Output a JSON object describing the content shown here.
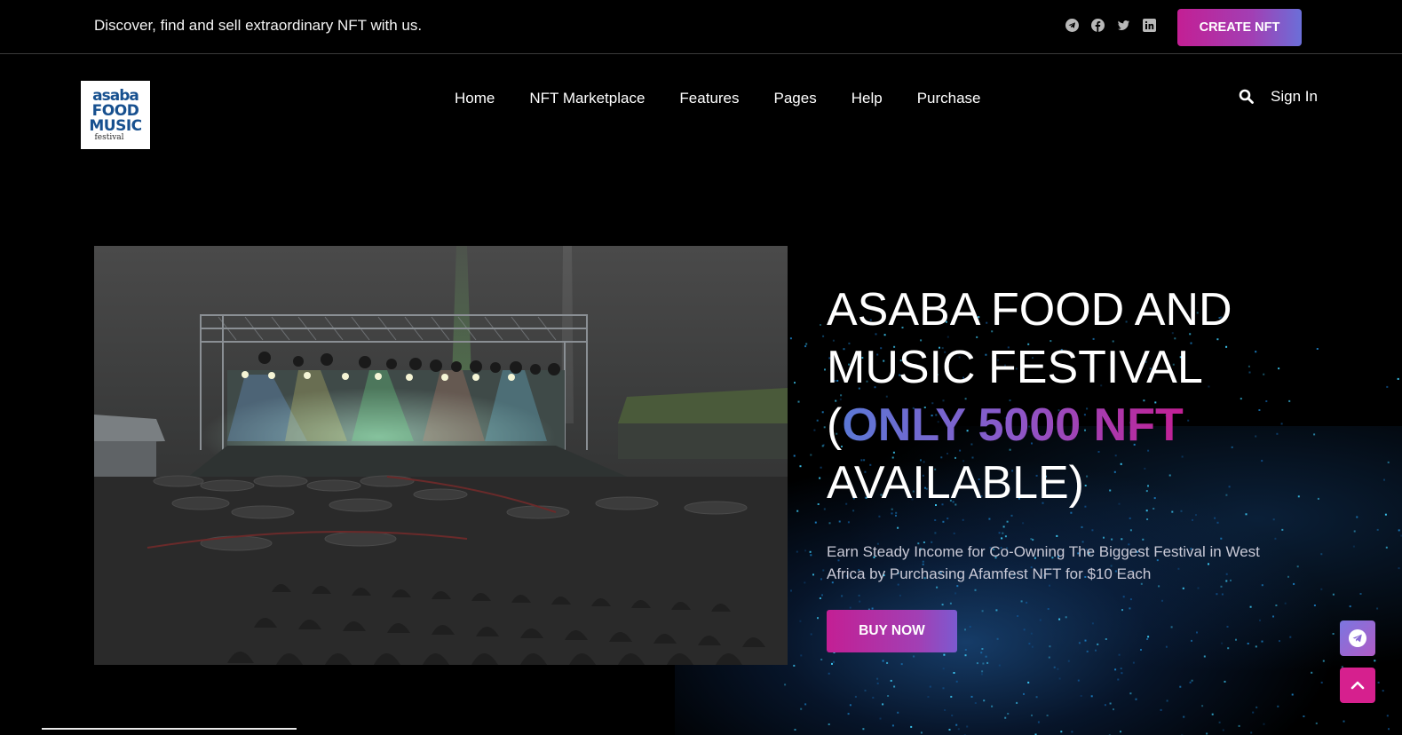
{
  "topbar": {
    "tagline": "Discover, find and sell extraordinary NFT with us.",
    "socials": [
      "telegram-icon",
      "facebook-icon",
      "twitter-icon",
      "linkedin-icon"
    ],
    "create_label": "CREATE NFT"
  },
  "header": {
    "logo": {
      "line1": "asaba",
      "line2": "FOOD",
      "line3": "MUSIC",
      "line4": "festival"
    },
    "nav": [
      "Home",
      "NFT Marketplace",
      "Features",
      "Pages",
      "Help",
      "Purchase"
    ],
    "signin_label": "Sign In"
  },
  "hero": {
    "title_part1": "ASABA FOOD AND MUSIC FESTIVAL (",
    "title_highlight": "ONLY 5000 NFT",
    "title_part2": " AVAILABLE)",
    "description": "Earn Steady Income for Co-Owning The Biggest Festival in West Africa by Purchasing Afamfest NFT for $10 Each",
    "buy_label": "BUY NOW"
  },
  "colors": {
    "accent_pink": "#c31f94",
    "accent_purple": "#7c5ad0",
    "accent_blue": "#5b78d6",
    "background": "#000000"
  }
}
